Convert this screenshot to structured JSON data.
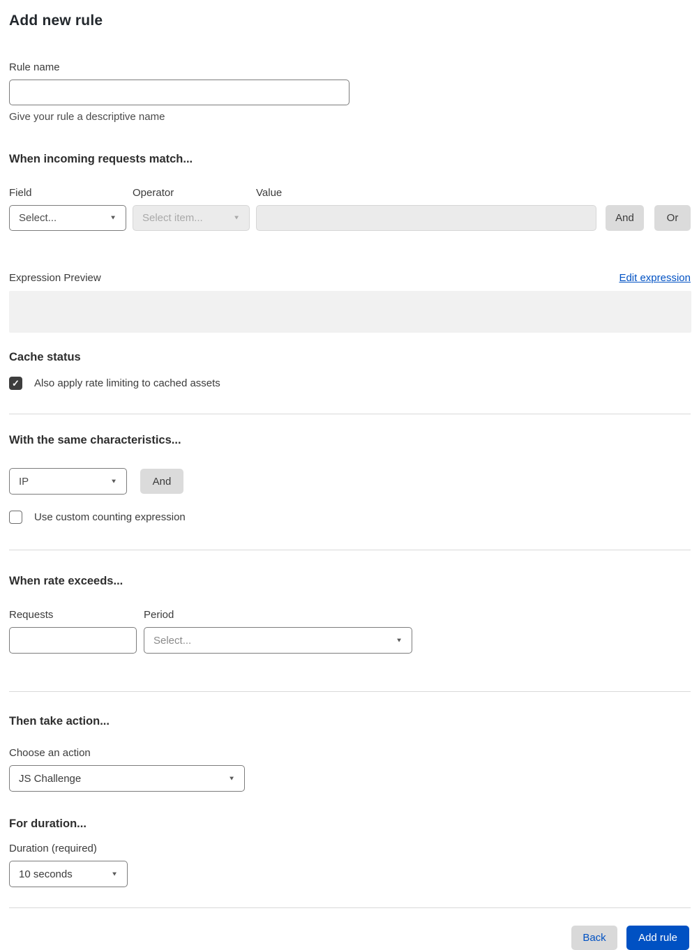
{
  "page": {
    "title": "Add new rule"
  },
  "colors": {
    "accent_blue": "#0051c3",
    "checkbox_checked": "#3d3d3d",
    "disabled_bg": "#ebebeb",
    "button_gray": "#dbdbdb",
    "preview_bg": "#f1f1f1",
    "divider": "#d9d9d9"
  },
  "icons": {
    "caret_down": "▼",
    "check": "✓"
  },
  "rule_name": {
    "label": "Rule name",
    "value": "",
    "placeholder": "",
    "helper": "Give your rule a descriptive name"
  },
  "match": {
    "heading": "When incoming requests match...",
    "field": {
      "label": "Field",
      "value": "Select..."
    },
    "operator": {
      "label": "Operator",
      "value": "Select item...",
      "disabled": true
    },
    "value": {
      "label": "Value",
      "value": "",
      "disabled": true
    },
    "and_label": "And",
    "or_label": "Or"
  },
  "expression": {
    "label": "Expression Preview",
    "edit_link": "Edit expression",
    "value": ""
  },
  "cache": {
    "heading": "Cache status",
    "checkbox_label": "Also apply rate limiting to cached assets",
    "checked": true
  },
  "characteristics": {
    "heading": "With the same characteristics...",
    "select_value": "IP",
    "and_label": "And",
    "checkbox_label": "Use custom counting expression",
    "checked": false
  },
  "rate": {
    "heading": "When rate exceeds...",
    "requests": {
      "label": "Requests",
      "value": ""
    },
    "period": {
      "label": "Period",
      "value": "Select..."
    }
  },
  "action": {
    "heading": "Then take action...",
    "label": "Choose an action",
    "value": "JS Challenge"
  },
  "duration": {
    "heading": "For duration...",
    "label": "Duration (required)",
    "value": "10 seconds"
  },
  "footer": {
    "back_label": "Back",
    "submit_label": "Add rule"
  }
}
